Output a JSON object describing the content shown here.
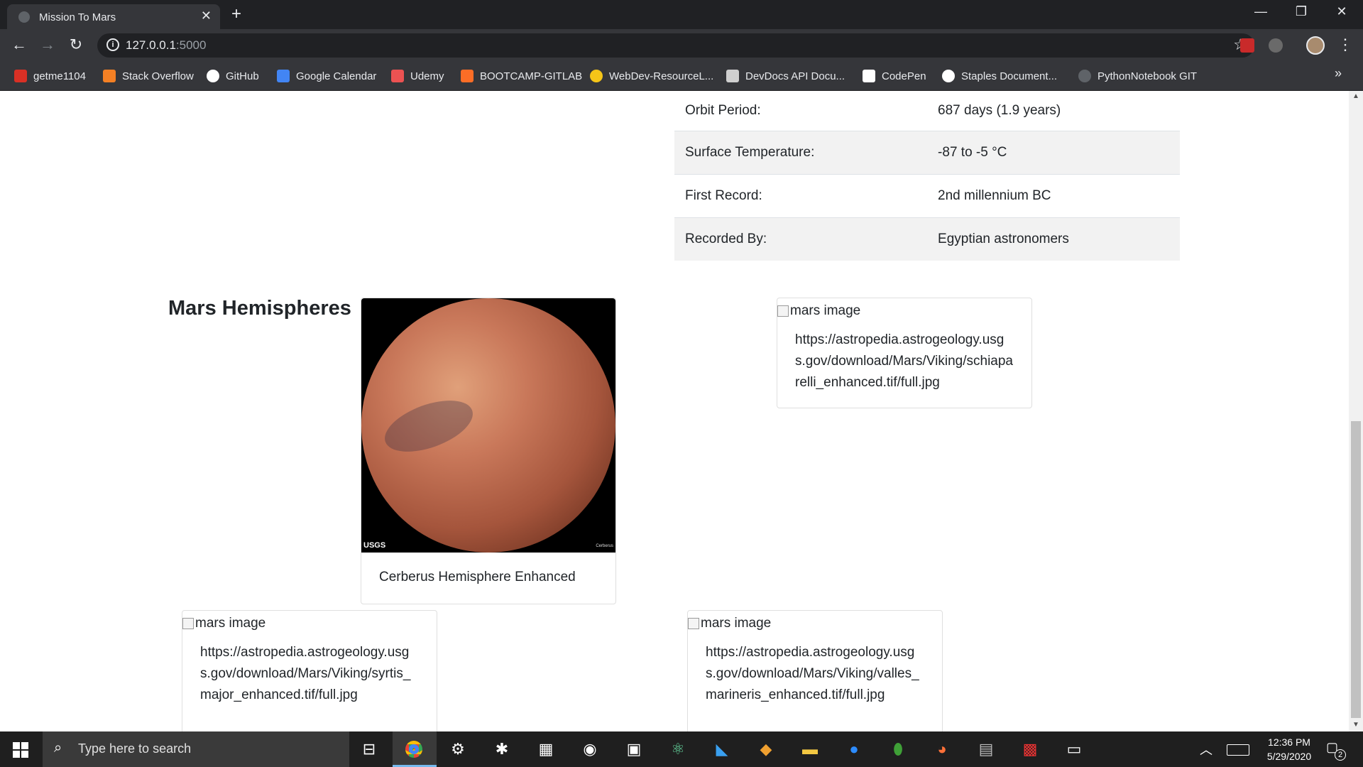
{
  "browser": {
    "tab_title": "Mission To Mars",
    "tab_close": "✕",
    "new_tab": "+",
    "url_host": "127.0.0.1",
    "url_port": ":5000",
    "window_controls": [
      "—",
      "❐",
      "✕"
    ],
    "bookmarks": [
      {
        "label": "getme1104",
        "icon": "gmail-icon",
        "color": "#d93025"
      },
      {
        "label": "Stack Overflow",
        "icon": "stackoverflow-icon",
        "color": "#f48024"
      },
      {
        "label": "GitHub",
        "icon": "github-icon",
        "color": "#ffffff"
      },
      {
        "label": "Google Calendar",
        "icon": "calendar-icon",
        "color": "#4285f4"
      },
      {
        "label": "Udemy",
        "icon": "udemy-icon",
        "color": "#ec5252"
      },
      {
        "label": "BOOTCAMP-GITLAB",
        "icon": "gitlab-icon",
        "color": "#fc6d26"
      },
      {
        "label": "WebDev-ResourceL...",
        "icon": "webdev-icon",
        "color": "#f5c518"
      },
      {
        "label": "DevDocs API Docu...",
        "icon": "devdocs-icon",
        "color": "#cfcfcf"
      },
      {
        "label": "CodePen",
        "icon": "codepen-icon",
        "color": "#ffffff"
      },
      {
        "label": "Staples Document...",
        "icon": "staples-icon",
        "color": "#ffffff"
      },
      {
        "label": "PythonNotebook GIT",
        "icon": "github-icon",
        "color": "#5f6368"
      }
    ],
    "bookmarks_overflow": "»"
  },
  "facts": [
    {
      "label": "Orbit Period:",
      "value": "687 days (1.9 years)"
    },
    {
      "label": "Surface Temperature:",
      "value": "-87 to -5 °C"
    },
    {
      "label": "First Record:",
      "value": "2nd millennium BC"
    },
    {
      "label": "Recorded By:",
      "value": "Egyptian astronomers"
    }
  ],
  "hemispheres": {
    "heading": "Mars Hemispheres",
    "image_alt": "mars image",
    "cards": [
      {
        "title": "Cerberus Hemisphere Enhanced",
        "logo": "USGS",
        "image_caption": "Cerberus"
      },
      {
        "url": "https://astropedia.astrogeology.usgs.gov/download/Mars/Viking/schiaparelli_enhanced.tif/full.jpg"
      },
      {
        "url": "https://astropedia.astrogeology.usgs.gov/download/Mars/Viking/syrtis_major_enhanced.tif/full.jpg"
      },
      {
        "url": "https://astropedia.astrogeology.usgs.gov/download/Mars/Viking/valles_marineris_enhanced.tif/full.jpg"
      }
    ]
  },
  "taskbar": {
    "search_placeholder": "Type here to search",
    "time": "12:36 PM",
    "date": "5/29/2020",
    "notification_count": "2",
    "pinned": [
      "task-view-icon",
      "chrome-icon",
      "settings-icon",
      "slack-icon",
      "store-icon",
      "github-desktop-icon",
      "photos-icon",
      "atom-icon",
      "vscode-icon",
      "git-icon",
      "file-explorer-icon",
      "zoom-icon",
      "mongodb-icon",
      "firefox-icon",
      "app-icon",
      "puzzle-icon",
      "terminal-icon"
    ]
  }
}
